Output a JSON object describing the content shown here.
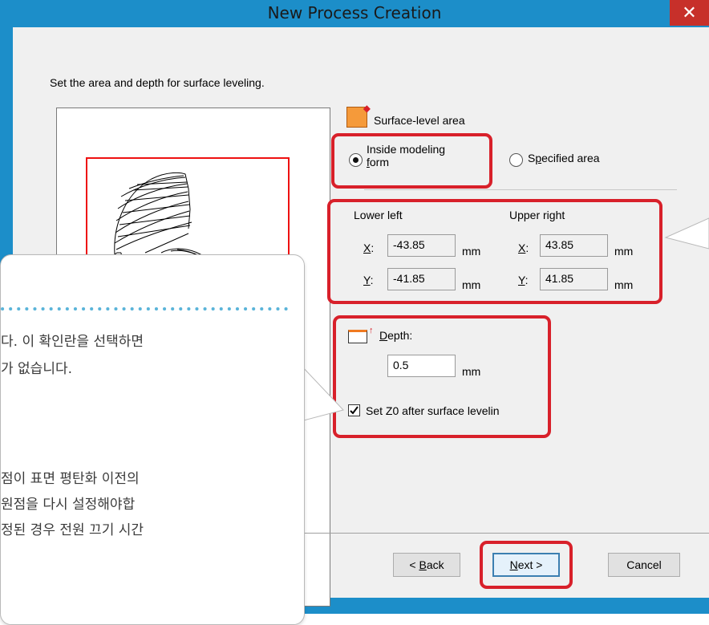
{
  "window": {
    "title": "New Process Creation",
    "close_glyph": "✕"
  },
  "dialog": {
    "instruction": "Set the area and depth for surface leveling.",
    "surface_level_area_label": "Surface-level area",
    "radio_inside": {
      "line1": "Inside modeling",
      "line2_mnemonic": "f",
      "line2_rest": "orm",
      "selected": true
    },
    "radio_specified": {
      "pre": "S",
      "mnemonic": "p",
      "rest": "ecified area",
      "selected": false
    },
    "lower_left_label": "Lower left",
    "upper_right_label": "Upper right",
    "x_label": "X",
    "y_label": "Y",
    "colon": ":",
    "lower_left_x": "-43.85",
    "lower_left_y": "-41.85",
    "upper_right_x": "43.85",
    "upper_right_y": "41.85",
    "unit": "mm",
    "depth_mnemonic": "D",
    "depth_rest": "epth:",
    "depth_value": "0.5",
    "set_z0_label": "Set Z0 after surface levelin",
    "set_z0_checked": true,
    "buttons": {
      "back_prefix": "< ",
      "back_mnemonic": "B",
      "back_rest": "ack",
      "next_mnemonic": "N",
      "next_rest": "ext >",
      "cancel": "Cancel"
    }
  },
  "callout": {
    "line1": "다. 이 확인란을 선택하면",
    "line2": "가 없습니다.",
    "line3": "점이 표면 평탄화 이전의",
    "line4": "원점을 다시 설정해야합",
    "line5": "정된 경우 전원 끄기 시간"
  },
  "colors": {
    "titlebar": "#1c8ec9",
    "highlight": "#d8202a",
    "close_button": "#c7302a",
    "dotted_rule": "#5ab4d9"
  }
}
